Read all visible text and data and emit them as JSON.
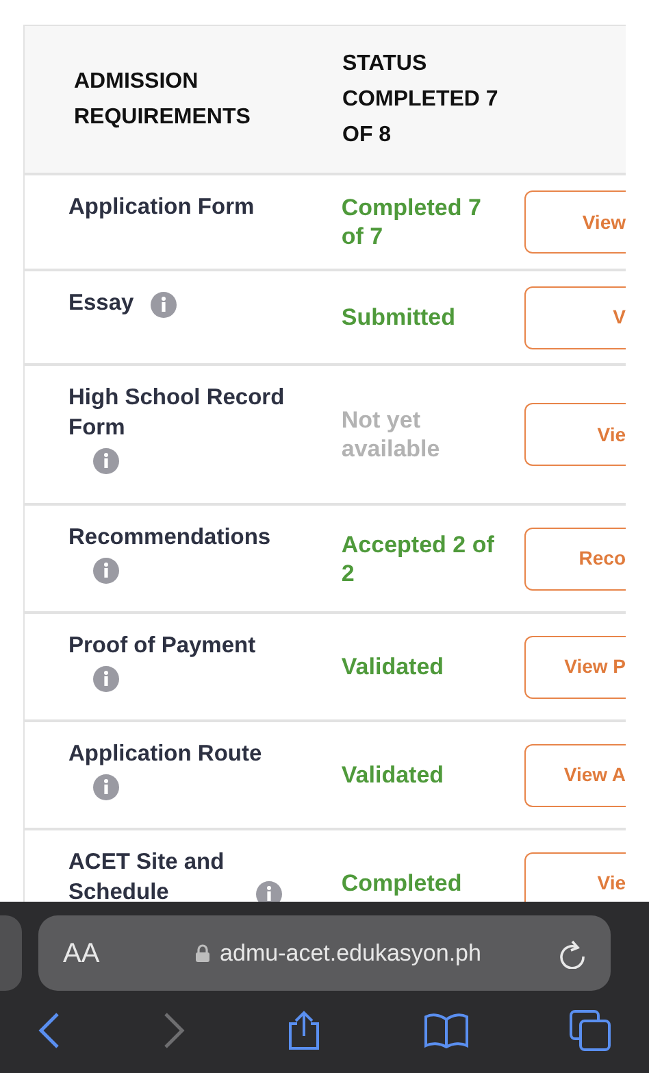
{
  "table": {
    "columns": [
      "ADMISSION REQUIREMENTS",
      "STATUS COMPLETED 7 OF 8"
    ],
    "rows": [
      {
        "name": "Application Form",
        "info": false,
        "status": "Completed 7 of 7",
        "kind": "done",
        "action": "View"
      },
      {
        "name": "Essay",
        "info": true,
        "status": "Submitted",
        "kind": "done",
        "action": "V"
      },
      {
        "name": "High School Record Form",
        "info": true,
        "status": "Not yet available",
        "kind": "pending",
        "action": "Vie"
      },
      {
        "name": "Recommendations",
        "info": true,
        "status": "Accepted 2 of 2",
        "kind": "done",
        "action": "Reco"
      },
      {
        "name": "Proof of Payment",
        "info": true,
        "status": "Validated",
        "kind": "done",
        "action": "View P"
      },
      {
        "name": "Application Route",
        "info": true,
        "status": "Validated",
        "kind": "done",
        "action": "View A"
      },
      {
        "name": "ACET Site and Schedule",
        "info": true,
        "status": "Completed",
        "kind": "done",
        "action": "Vie"
      }
    ]
  },
  "browser": {
    "text_size": "AA",
    "url": "admu-acet.edukasyon.ph",
    "back_disabled": false,
    "forward_disabled": true
  }
}
